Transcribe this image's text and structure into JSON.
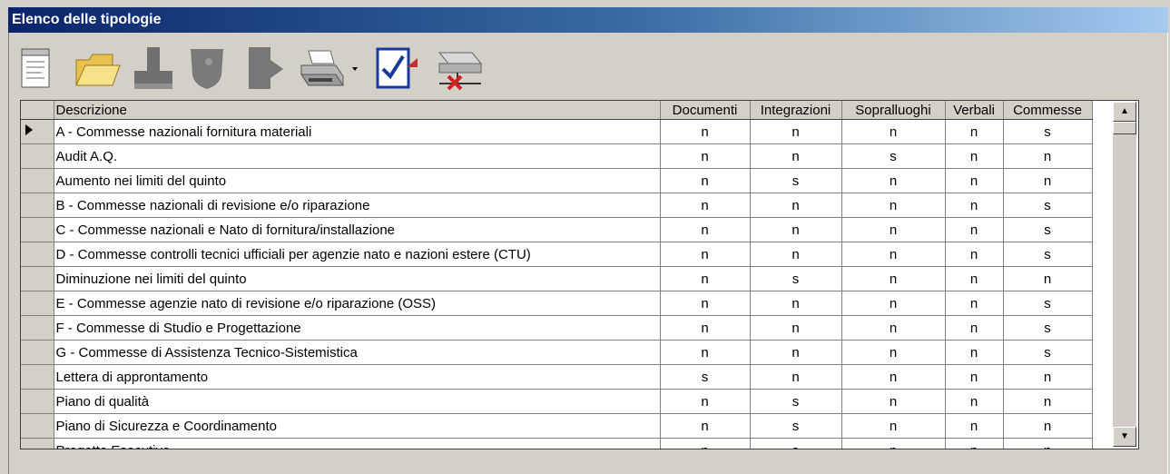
{
  "window": {
    "title": "Elenco delle tipologie"
  },
  "toolbar": {
    "buttons": [
      {
        "icon": "new-document-icon"
      },
      {
        "icon": "open-folder-icon"
      },
      {
        "icon": "stamp-icon"
      },
      {
        "icon": "shield-icon"
      },
      {
        "icon": "document-arrow-icon"
      },
      {
        "icon": "printer-icon"
      },
      {
        "icon": "checklist-icon"
      },
      {
        "icon": "disconnect-drive-icon"
      }
    ]
  },
  "grid": {
    "columns": [
      "Descrizione",
      "Documenti",
      "Integrazioni",
      "Sopralluoghi",
      "Verbali",
      "Commesse"
    ],
    "rows": [
      {
        "descrizione": "A - Commesse nazionali fornitura materiali",
        "documenti": "n",
        "integrazioni": "n",
        "sopralluoghi": "n",
        "verbali": "n",
        "commesse": "s"
      },
      {
        "descrizione": "Audit A.Q.",
        "documenti": "n",
        "integrazioni": "n",
        "sopralluoghi": "s",
        "verbali": "n",
        "commesse": "n"
      },
      {
        "descrizione": "Aumento nei limiti del quinto",
        "documenti": "n",
        "integrazioni": "s",
        "sopralluoghi": "n",
        "verbali": "n",
        "commesse": "n"
      },
      {
        "descrizione": "B - Commesse nazionali di revisione e/o riparazione",
        "documenti": "n",
        "integrazioni": "n",
        "sopralluoghi": "n",
        "verbali": "n",
        "commesse": "s"
      },
      {
        "descrizione": "C - Commesse nazionali e Nato di fornitura/installazione",
        "documenti": "n",
        "integrazioni": "n",
        "sopralluoghi": "n",
        "verbali": "n",
        "commesse": "s"
      },
      {
        "descrizione": "D - Commesse controlli tecnici ufficiali per agenzie nato e nazioni estere (CTU)",
        "documenti": "n",
        "integrazioni": "n",
        "sopralluoghi": "n",
        "verbali": "n",
        "commesse": "s"
      },
      {
        "descrizione": "Diminuzione nei limiti del quinto",
        "documenti": "n",
        "integrazioni": "s",
        "sopralluoghi": "n",
        "verbali": "n",
        "commesse": "n"
      },
      {
        "descrizione": "E - Commesse agenzie nato di revisione e/o riparazione (OSS)",
        "documenti": "n",
        "integrazioni": "n",
        "sopralluoghi": "n",
        "verbali": "n",
        "commesse": "s"
      },
      {
        "descrizione": "F - Commesse di Studio e Progettazione",
        "documenti": "n",
        "integrazioni": "n",
        "sopralluoghi": "n",
        "verbali": "n",
        "commesse": "s"
      },
      {
        "descrizione": "G - Commesse di Assistenza Tecnico-Sistemistica",
        "documenti": "n",
        "integrazioni": "n",
        "sopralluoghi": "n",
        "verbali": "n",
        "commesse": "s"
      },
      {
        "descrizione": "Lettera di approntamento",
        "documenti": "s",
        "integrazioni": "n",
        "sopralluoghi": "n",
        "verbali": "n",
        "commesse": "n"
      },
      {
        "descrizione": "Piano di qualità",
        "documenti": "n",
        "integrazioni": "s",
        "sopralluoghi": "n",
        "verbali": "n",
        "commesse": "n"
      },
      {
        "descrizione": "Piano di Sicurezza e Coordinamento",
        "documenti": "n",
        "integrazioni": "s",
        "sopralluoghi": "n",
        "verbali": "n",
        "commesse": "n"
      },
      {
        "descrizione": "Progetto Esecutivo",
        "documenti": "n",
        "integrazioni": "s",
        "sopralluoghi": "n",
        "verbali": "n",
        "commesse": "n"
      }
    ],
    "current_row": 0
  },
  "scrollbar": {
    "up_icon": "scroll-up-icon",
    "down_icon": "scroll-down-icon"
  }
}
